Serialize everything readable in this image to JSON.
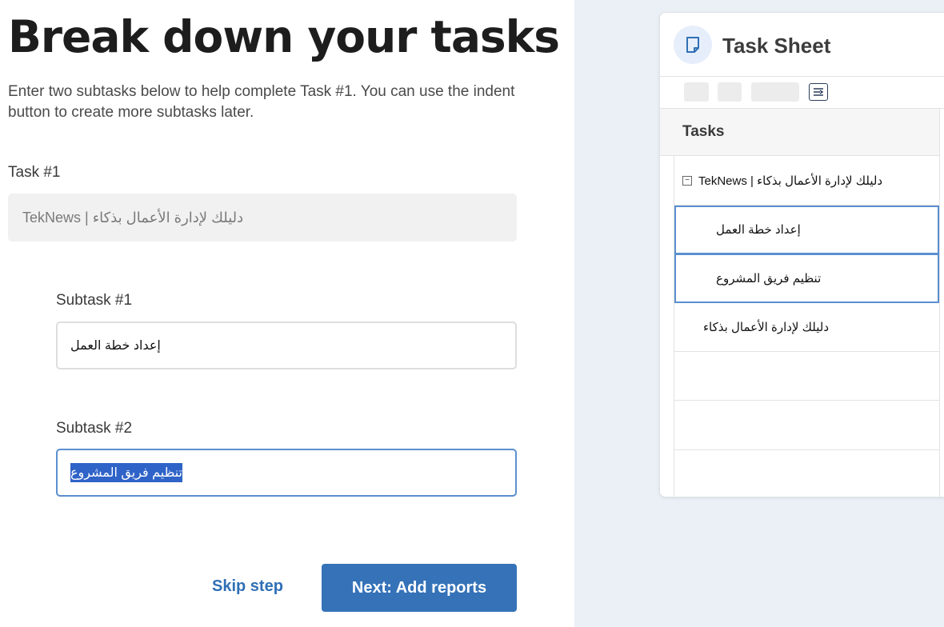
{
  "heading": "Break down your tasks",
  "intro": "Enter two subtasks below to help complete Task #1. You can use the indent button to create more subtasks later.",
  "task1": {
    "label": "Task #1",
    "value": "دليلك لإدارة الأعمال بذكاء | TekNews"
  },
  "subtask1": {
    "label": "Subtask #1",
    "value": "إعداد خطة العمل"
  },
  "subtask2": {
    "label": "Subtask #2",
    "value": "تنظيم فريق المشروع"
  },
  "actions": {
    "skip": "Skip step",
    "next": "Next: Add reports"
  },
  "sheet": {
    "title": "Task Sheet",
    "column_header": "Tasks",
    "rows": [
      "دليلك لإدارة الأعمال بذكاء | TekNews",
      "إعداد خطة العمل",
      "تنظيم فريق المشروع",
      "دليلك لإدارة الأعمال بذكاء",
      "",
      "",
      ""
    ]
  },
  "colors": {
    "primary": "#3572b8",
    "link": "#2f6fb6",
    "focus": "#5b8fd0",
    "selection": "#2f63c8",
    "panel_bg": "#ebf0f7"
  },
  "icons": {
    "sheet": "document-icon",
    "indent": "indent-icon",
    "collapse": "collapse-icon"
  }
}
